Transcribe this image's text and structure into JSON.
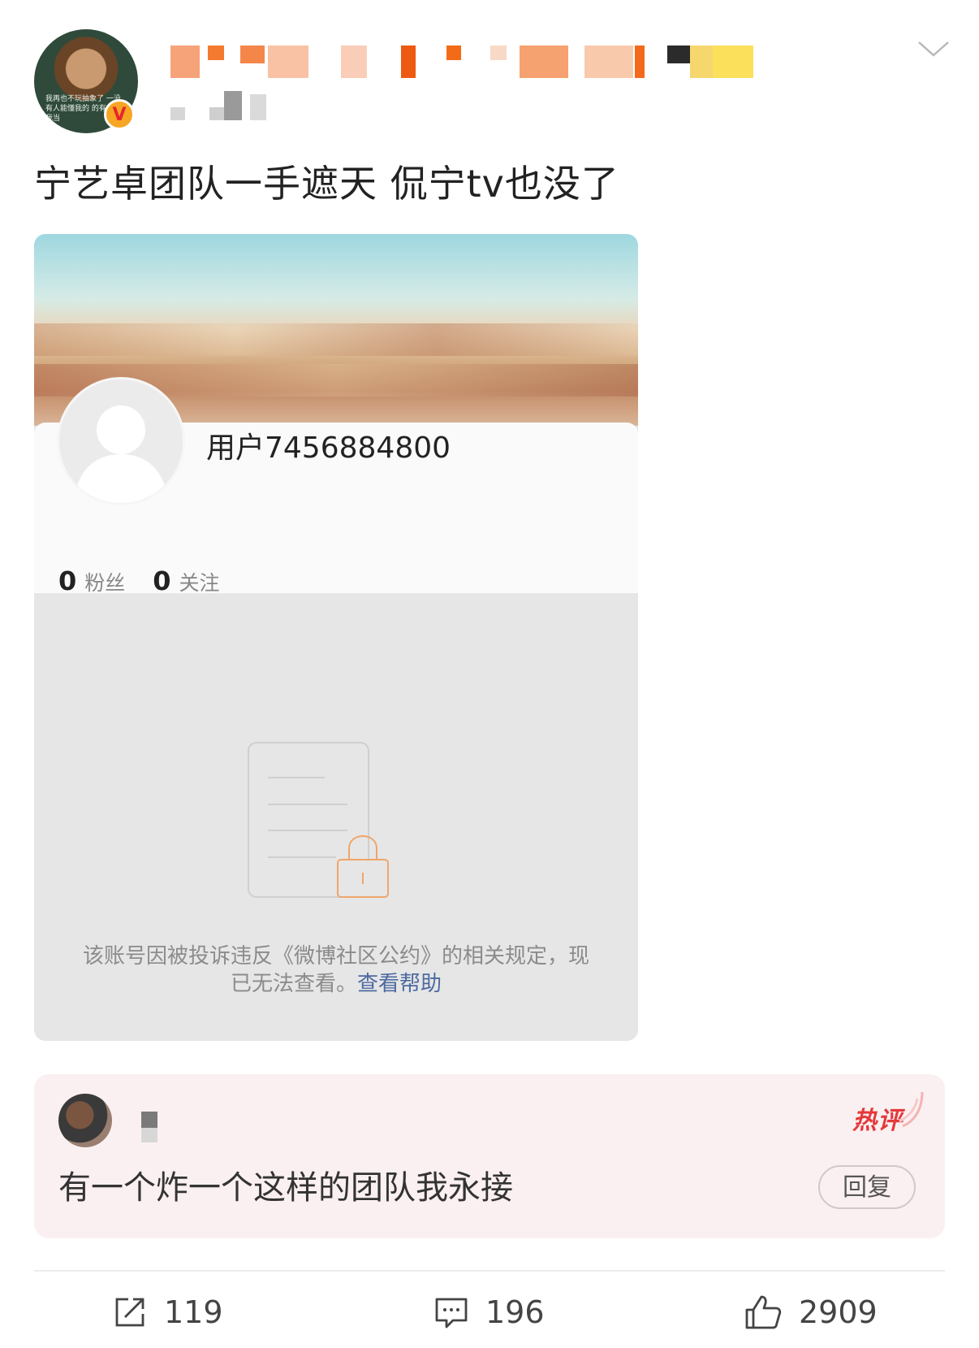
{
  "post": {
    "author_avatar_caption": "我再也不玩抽象了 一没有人能懂我的 的有人把我当",
    "verified_badge": "V",
    "text": "宁艺卓团队一手遮天 侃宁tv也没了"
  },
  "embedded_profile": {
    "username": "用户7456884800",
    "followers_count": "0",
    "followers_label": "粉丝",
    "following_count": "0",
    "following_label": "关注",
    "notice_text": "该账号因被投诉违反《微博社区公约》的相关规定，现已无法查看。",
    "help_link": "查看帮助"
  },
  "hot_comment": {
    "tag": "热评",
    "text": "有一个炸一个这样的团队我永接",
    "reply_label": "回复"
  },
  "actions": {
    "repost_count": "119",
    "comment_count": "196",
    "like_count": "2909"
  },
  "icons": [
    "chevron-down-icon",
    "locked-document-icon",
    "repost-icon",
    "comment-icon",
    "like-icon"
  ],
  "colors": {
    "verified_badge": "#f7a623",
    "hot_tag": "#e4393c",
    "help_link": "#4d6aa0",
    "lock_icon": "#f0a56a"
  }
}
